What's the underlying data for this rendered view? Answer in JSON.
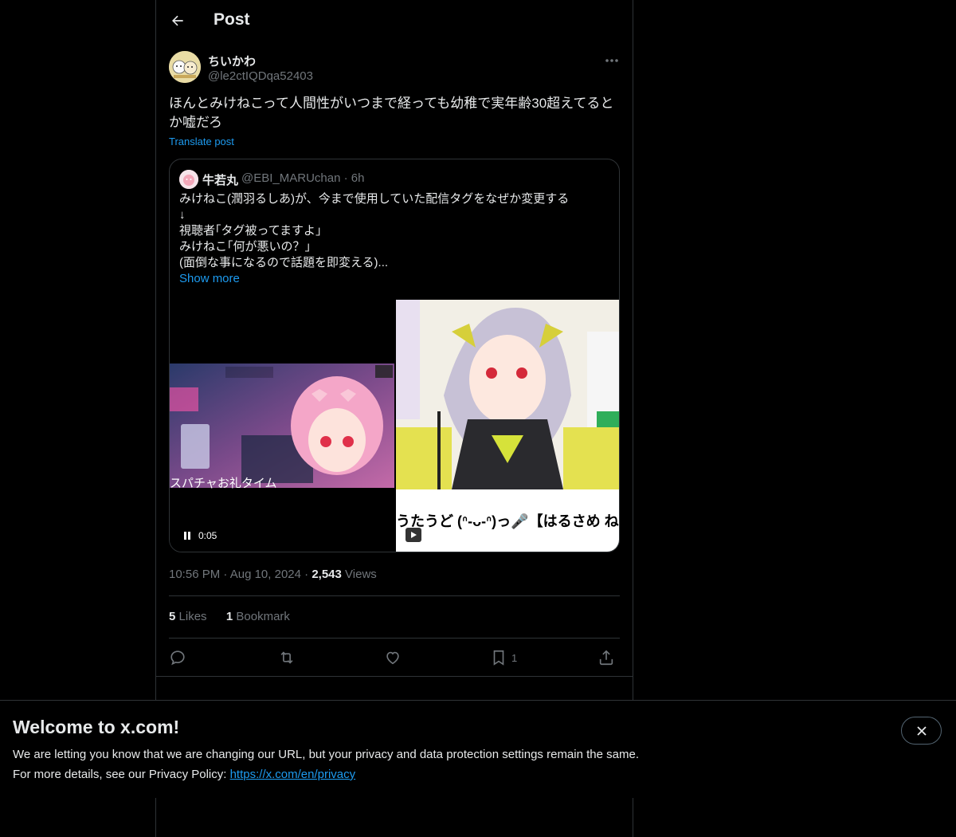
{
  "header": {
    "title": "Post"
  },
  "post": {
    "display_name": "ちいかわ",
    "handle": "@le2ctIQDqa52403",
    "text": "ほんとみけねこって人間性がいつまで経っても幼稚で実年齢30超えてるとか嘘だろ",
    "translate_label": "Translate post",
    "time": "10:56 PM",
    "date": "Aug 10, 2024",
    "views_count": "2,543",
    "views_label": "Views",
    "likes_count": "5",
    "likes_label": "Likes",
    "bookmarks_count": "1",
    "bookmarks_label": "Bookmark",
    "bookmark_action_count": "1"
  },
  "quote": {
    "display_name": "牛若丸",
    "handle": "@EBI_MARUchan",
    "age": "· 6h",
    "lines": [
      "みけねこ(潤羽るしあ)が、今まで使用していた配信タグをなぜか変更する",
      "↓",
      "視聴者｢タグ被ってますよ｣",
      "みけねこ｢何が悪いの？｣",
      "(面倒な事になるので話題を即変える)..."
    ],
    "show_more": "Show more",
    "video_caption": "スパチャお礼タイム",
    "video_time": "0:05",
    "thumb_caption": "うたうど (ᐢ-ᴗ-ᐢ)っ🎤【はるさめ ね"
  },
  "banner": {
    "title": "Welcome to x.com!",
    "line1": "We are letting you know that we are changing our URL, but your privacy and data protection settings remain the same.",
    "line2_prefix": "For more details, see our Privacy Policy: ",
    "link": "https://x.com/en/privacy"
  },
  "colors": {
    "accent": "#1d9bf0",
    "muted": "#71767b",
    "border": "#2f3336",
    "text": "#e7e9ea"
  },
  "icons": [
    "back-arrow-icon",
    "more-icon",
    "reply-icon",
    "repost-icon",
    "like-icon",
    "bookmark-icon",
    "share-icon",
    "pause-icon",
    "play-icon",
    "close-icon"
  ]
}
